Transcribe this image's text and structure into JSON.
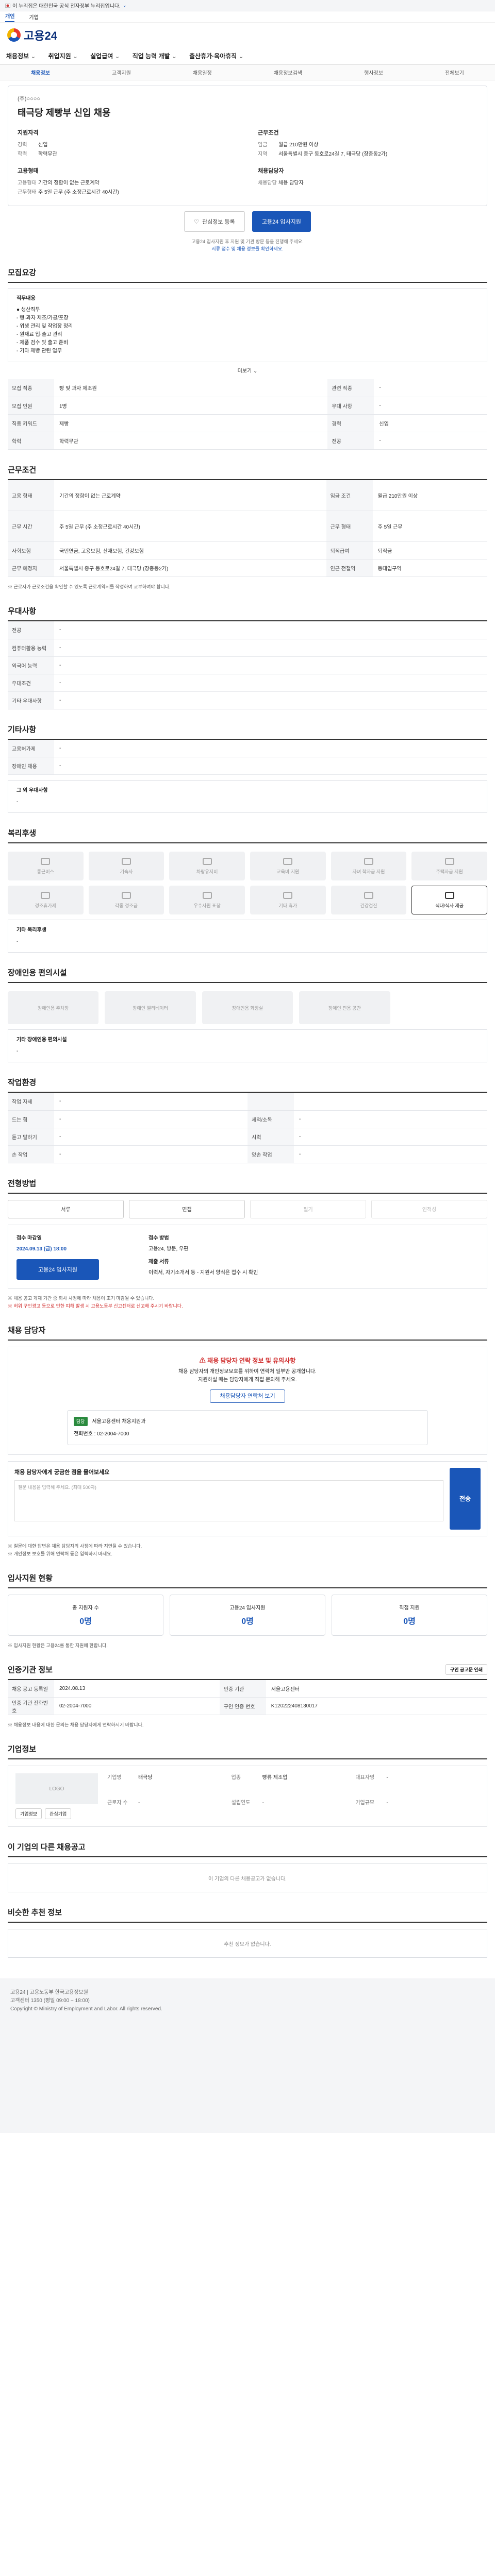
{
  "gov_banner": {
    "text": "이 누리집은 대한민국 공식 전자정부 누리집입니다.",
    "toggle": "⌄"
  },
  "topbar": {
    "items": [
      "개인",
      "기업"
    ]
  },
  "header": {
    "logo": "고용24"
  },
  "gnb": {
    "items": [
      "채용정보",
      "취업지원",
      "실업급여",
      "직업 능력 개발",
      "출산휴가·육아휴직"
    ]
  },
  "subnav": {
    "items": [
      "채용정보",
      "고객지원",
      "채용일정",
      "채용정보검색",
      "행사정보",
      "전체보기"
    ]
  },
  "job": {
    "company": "(주)○○○○",
    "title": "태극당 제빵부 신입 채용",
    "qual_title": "지원자격",
    "cond_title": "근무조건",
    "type_title": "고용형태",
    "manager_title": "채용담당자",
    "qual": [
      [
        "경력",
        "신입"
      ],
      [
        "학력",
        "학력무관"
      ]
    ],
    "cond": [
      [
        "임금",
        "월급 210만원 이상"
      ],
      [
        "지역",
        "서울특별시 중구 동호로24길 7, 태극당 (장충동2가)"
      ]
    ],
    "type": [
      [
        "고용형태",
        "기간의 정함이 없는 근로계약"
      ],
      [
        "근무형태",
        "주 5일 근무 (주 소정근로시간 40시간)"
      ]
    ],
    "manager": [
      [
        "채용담당",
        "채용 담당자"
      ]
    ],
    "btn_interest": "관심정보 등록",
    "btn_apply": "고용24 입사지원",
    "note1": "고용24 입사지원 후 지원 및 기관 방문 등을 진행해 주세요.",
    "note2": "서류 접수 및 채용 정보를 확인하세요."
  },
  "recruit": {
    "title": "모집요강",
    "duty_label": "직무내용",
    "duty_text": "● 생산직무\n- 빵·과자 제조/가공/포장\n- 위생 관리 및 작업장 정리\n- 원재료 입·출고 관리\n- 제품 검수 및 출고 준비\n- 기타 제빵 관련 업무",
    "more": "더보기 ⌄",
    "rows": [
      [
        "모집 직종",
        "빵 및 과자 제조원",
        "관련 직종",
        "-"
      ],
      [
        "모집 인원",
        "1명",
        "우대 사항",
        "-"
      ],
      [
        "직종 키워드",
        "제빵",
        "경력",
        "신입"
      ],
      [
        "학력",
        "학력무관",
        "전공",
        "-"
      ]
    ]
  },
  "work": {
    "title": "근무조건",
    "rows": [
      [
        "고용 형태",
        "기간의 정함이 없는 근로계약",
        "임금 조건",
        "월급 210만원 이상"
      ],
      [
        "근무 시간",
        "주 5일 근무 (주 소정근로시간 40시간)",
        "근무 형태",
        "주 5일 근무"
      ],
      [
        "사회보험",
        "국민연금, 고용보험, 산재보험, 건강보험",
        "퇴직급여",
        "퇴직금"
      ],
      [
        "근무 예정지",
        "서울특별시 중구 동호로24길 7, 태극당 (장충동2가)",
        "인근 전철역",
        "동대입구역"
      ]
    ],
    "note": "※ 근로자가 근로조건을 확인할 수 있도록 근로계약서를 작성하여 교부하여야 합니다."
  },
  "prefer": {
    "title": "우대사항",
    "rows": [
      [
        "전공",
        "-"
      ],
      [
        "컴퓨터활용 능력",
        "-"
      ],
      [
        "외국어 능력",
        "-"
      ],
      [
        "우대조건",
        "-"
      ],
      [
        "기타 우대사항",
        "-"
      ]
    ]
  },
  "etc": {
    "title": "기타사항",
    "rows": [
      [
        "고용허가제",
        "-"
      ],
      [
        "장애인 채용",
        "-"
      ]
    ],
    "extra_label": "그 외 우대사항",
    "extra_value": "-"
  },
  "benefit": {
    "title": "복리후생",
    "items": [
      "통근버스",
      "기숙사",
      "차량유지비",
      "교육비 지원",
      "자녀 학자금 지원",
      "주택자금 지원",
      "경조휴가제",
      "각종 경조금",
      "우수사원 표창",
      "기타 휴가",
      "건강검진",
      "식대/식사 제공"
    ],
    "extra_label": "기타 복리후생",
    "extra_value": "-"
  },
  "accessible": {
    "title": "장애인용 편의시설",
    "items": [
      "장애인용 주차장",
      "장애인 엘리베이터",
      "장애인용 화장실",
      "장애인 전용 공간"
    ],
    "extra_label": "기타 장애인용 편의시설",
    "extra_value": "-"
  },
  "workplace": {
    "title": "작업환경",
    "rows": [
      [
        "작업 자세",
        "-",
        "",
        ""
      ],
      [
        "드는 힘",
        "-",
        "세척/소독",
        "-"
      ],
      [
        "듣고 말하기",
        "-",
        "시력",
        "-"
      ],
      [
        "손 작업",
        "-",
        "양손 작업",
        "-"
      ]
    ]
  },
  "method": {
    "title": "전형방법",
    "tabs": [
      "서류",
      "면접",
      "필기",
      "인적성"
    ],
    "deadline_label": "접수 마감일",
    "deadline_value": "2024.09.13 (금) 18:00",
    "method_label": "접수 방법",
    "method_value": "고용24, 방문, 우편",
    "submit_label": "제출 서류",
    "submit_value": "이력서, 자기소개서 등 - 지원서 양식은 접수 시 확인",
    "apply": "고용24 입사지원",
    "warns": [
      "※ 채용 공고 게재 기간 중 회사 사정에 따라 채용이 조기 마감될 수 있습니다.",
      "※ 허위 구인광고 등으로 인한 피해 발생 시 고용노동부 신고센터로 신고해 주시기 바랍니다."
    ]
  },
  "contact": {
    "title": "채용 담당자",
    "alert_title": "채용 담당자 연락 정보 및 유의사항",
    "alert_text1": "채용 담당자의 개인정보보호를 위하여 연락처 일부만 공개합니다.",
    "alert_text2": "지원하실 때는 담당자에게 직접 문의해 주세요.",
    "view_btn": "채용담당자 연락처 보기",
    "company_tag": "담당",
    "company_name": "서울고용센터 채용지원과",
    "phone_label": "전화번호",
    "phone": "02-2004-7000",
    "q_title": "채용 담당자에게 궁금한 점을 물어보세요",
    "q_placeholder": "질문 내용을 입력해 주세요. (최대 500자)",
    "send": "전송",
    "notes": [
      "※ 질문에 대한 답변은 채용 담당자의 사정에 따라 지연될 수 있습니다.",
      "※ 개인정보 보호를 위해 연락처 등은 입력하지 마세요."
    ]
  },
  "status": {
    "title": "입사지원 현황",
    "items": [
      [
        "총 지원자 수",
        "0명"
      ],
      [
        "고용24 입사지원",
        "0명"
      ],
      [
        "직접 지원",
        "0명"
      ]
    ],
    "note": "※ 입사지원 현황은 고용24를 통한 지원에 한합니다."
  },
  "info": {
    "title": "인증기관 정보",
    "print": "구인 공고문 인쇄",
    "rows": [
      [
        "채용 공고 등록일",
        "2024.08.13",
        "인증 기관",
        "서울고용센터"
      ],
      [
        "인증 기관 전화번호",
        "02-2004-7000",
        "구인 인증 번호",
        "K120222408130017"
      ]
    ],
    "note": "※ 채용정보 내용에 대한 문의는 채용 담당자에게 연락하시기 바랍니다."
  },
  "company": {
    "title": "기업정보",
    "logo": "LOGO",
    "btn1": "기업정보",
    "btn2": "관심기업",
    "fields": [
      [
        "기업명",
        "태극당"
      ],
      [
        "업종",
        "빵류 제조업"
      ],
      [
        "대표자명",
        "-"
      ],
      [
        "근로자 수",
        "-"
      ],
      [
        "설립연도",
        "-"
      ],
      [
        "기업규모",
        "-"
      ]
    ]
  },
  "other": {
    "title": "이 기업의 다른 채용공고",
    "empty": "이 기업의 다른 채용공고가 없습니다."
  },
  "similar": {
    "title": "비슷한 추천 정보",
    "empty": "추천 정보가 없습니다."
  },
  "footer": {
    "line1": "고용24 | 고용노동부 한국고용정보원",
    "line2": "고객센터 1350 (평일 09:00 ~ 18:00)",
    "line3": "Copyright © Ministry of Employment and Labor. All rights reserved."
  }
}
